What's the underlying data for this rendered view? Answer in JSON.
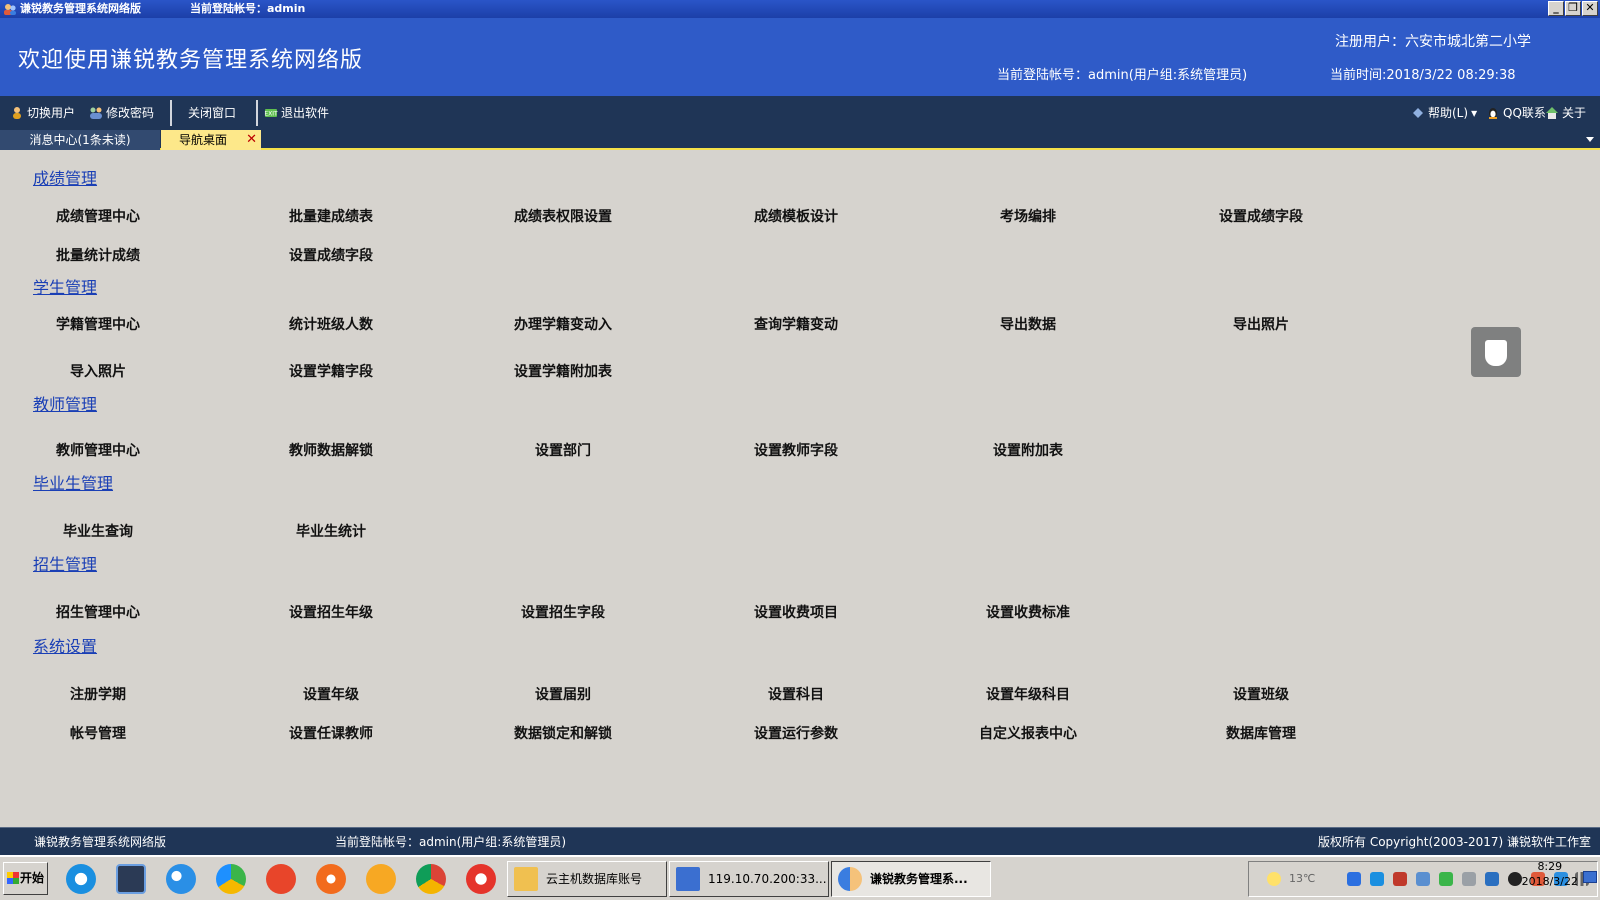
{
  "titlebar": {
    "title": "谦锐教务管理系统网络版",
    "account": "当前登陆帐号：admin",
    "buttons": [
      "_",
      "❐",
      "✕"
    ]
  },
  "banner": {
    "welcome": "欢迎使用谦锐教务管理系统网络版",
    "registered_user": "注册用户：六安市城北第二小学",
    "current_account": "当前登陆帐号：admin(用户组:系统管理员)",
    "current_time": "当前时间:2018/3/22  08:29:38"
  },
  "toolbar": {
    "switch_user": "切换用户",
    "change_password": "修改密码",
    "close_window": "关闭窗口",
    "exit": "退出软件",
    "help": "帮助(L)",
    "help_dropdown": "▾",
    "qq_contact": "QQ联系",
    "about": "关于"
  },
  "tabs": {
    "message_center": "消息中心(1条未读)",
    "nav_desktop": "导航桌面",
    "close": "✕"
  },
  "sections": {
    "grades": {
      "title": "成绩管理",
      "items": [
        "成绩管理中心",
        "批量建成绩表",
        "成绩表权限设置",
        "成绩模板设计",
        "考场编排",
        "设置成绩字段",
        "批量统计成绩",
        "设置成绩字段"
      ]
    },
    "students": {
      "title": "学生管理",
      "items": [
        "学籍管理中心",
        "统计班级人数",
        "办理学籍变动入",
        "查询学籍变动",
        "导出数据",
        "导出照片",
        "导入照片",
        "设置学籍字段",
        "设置学籍附加表"
      ]
    },
    "teachers": {
      "title": "教师管理",
      "items": [
        "教师管理中心",
        "教师数据解锁",
        "设置部门",
        "设置教师字段",
        "设置附加表"
      ]
    },
    "graduates": {
      "title": "毕业生管理",
      "items": [
        "毕业生查询",
        "毕业生统计"
      ]
    },
    "admissions": {
      "title": "招生管理",
      "items": [
        "招生管理中心",
        "设置招生年级",
        "设置招生字段",
        "设置收费项目",
        "设置收费标准"
      ]
    },
    "system": {
      "title": "系统设置",
      "items": [
        "注册学期",
        "设置年级",
        "设置届别",
        "设置科目",
        "设置年级科目",
        "设置班级",
        "帐号管理",
        "设置任课教师",
        "数据锁定和解锁",
        "设置运行参数",
        "自定义报表中心",
        "数据库管理"
      ]
    }
  },
  "statusbar": {
    "app_name": "谦锐教务管理系统网络版",
    "account": "当前登陆帐号：admin(用户组:系统管理员)",
    "copyright": "版权所有 Copyright(2003-2017) 谦锐软件工作室"
  },
  "taskbar": {
    "start": "开始",
    "tasks": [
      "云主机数据库账号",
      "119.10.70.200:33...",
      "谦锐教务管理系..."
    ],
    "temperature": "13℃",
    "clock_time": "8:29",
    "clock_date": "2018/3/22"
  },
  "colors": {
    "banner": "#2f5bc8",
    "toolbar": "#1f3556",
    "content_bg": "#d6d3ce",
    "section_link": "#1a3fb5",
    "active_tab": "#fde88a"
  }
}
